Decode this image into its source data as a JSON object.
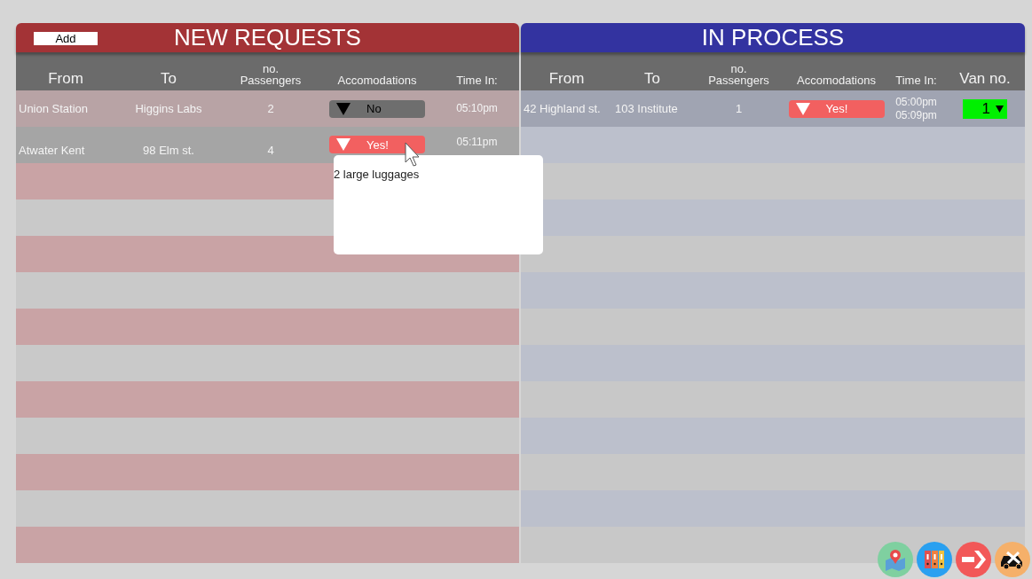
{
  "new_requests": {
    "add_button": "Add",
    "title": "NEW REQUESTS",
    "columns": [
      "From",
      "To",
      "no.\nPassengers",
      "Accomodations",
      "Time In:"
    ],
    "rows": [
      {
        "from": "Union Station",
        "to": "Higgins Labs",
        "passengers": "2",
        "accommodation": {
          "value": "No",
          "needed": false,
          "expanded": false
        },
        "times": [
          "05:10pm"
        ]
      },
      {
        "from": "Atwater Kent",
        "to": "98 Elm st.",
        "passengers": "4",
        "accommodation": {
          "value": "Yes!",
          "needed": true,
          "expanded": true,
          "note": "2 large luggages"
        },
        "times": [
          "05:11pm"
        ]
      }
    ]
  },
  "in_process": {
    "title": "IN PROCESS",
    "columns": [
      "From",
      "To",
      "no.\nPassengers",
      "Accomodations",
      "Time In:",
      "Van no."
    ],
    "rows": [
      {
        "from": "42 Highland st.",
        "to": "103 Institute",
        "passengers": "1",
        "accommodation": {
          "value": "Yes!",
          "needed": true
        },
        "times": [
          "05:00pm",
          "05:09pm"
        ],
        "van": "1"
      }
    ]
  },
  "toolbar": [
    {
      "kind": "map"
    },
    {
      "kind": "folders"
    },
    {
      "kind": "arrow"
    },
    {
      "kind": "car"
    }
  ]
}
